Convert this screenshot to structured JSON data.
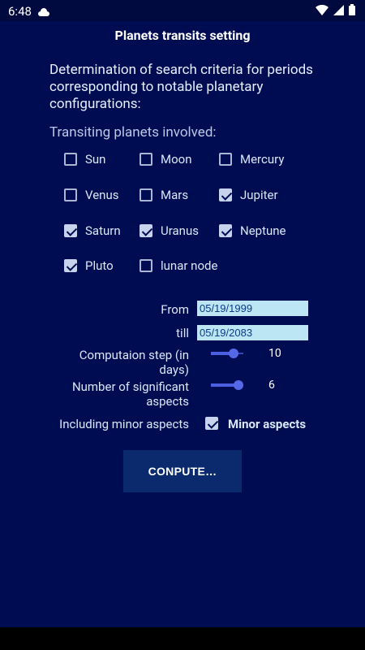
{
  "status_bar": {
    "time": "6:48"
  },
  "title": "Planets transits setting",
  "intro": "Determination of search criteria for periods corresponding to notable planetary configurations:",
  "planets_label": "Transiting planets involved:",
  "planets": [
    {
      "label": "Sun",
      "checked": false
    },
    {
      "label": "Moon",
      "checked": false
    },
    {
      "label": "Mercury",
      "checked": false
    },
    {
      "label": "Venus",
      "checked": false
    },
    {
      "label": "Mars",
      "checked": false
    },
    {
      "label": "Jupiter",
      "checked": true
    },
    {
      "label": "Saturn",
      "checked": true
    },
    {
      "label": "Uranus",
      "checked": true
    },
    {
      "label": "Neptune",
      "checked": true
    },
    {
      "label": "Pluto",
      "checked": true
    },
    {
      "label": "lunar node",
      "checked": false
    }
  ],
  "from": {
    "label": "From",
    "value": "05/19/1999"
  },
  "till": {
    "label": "till",
    "value": "05/19/2083"
  },
  "step": {
    "label": "Computaion step (in days)",
    "value": "10",
    "fraction": 0.7
  },
  "aspects": {
    "label": "Number of significant aspects",
    "value": "6",
    "fraction": 0.85
  },
  "minor": {
    "label": "Including minor aspects",
    "checkbox_label": "Minor aspects",
    "checked": true
  },
  "compute_label": "CONPUTE…",
  "colors": {
    "background": "#000c52",
    "input_bg": "#bde6f5",
    "button_bg": "#0b2a6e",
    "accent": "#5468e8"
  }
}
